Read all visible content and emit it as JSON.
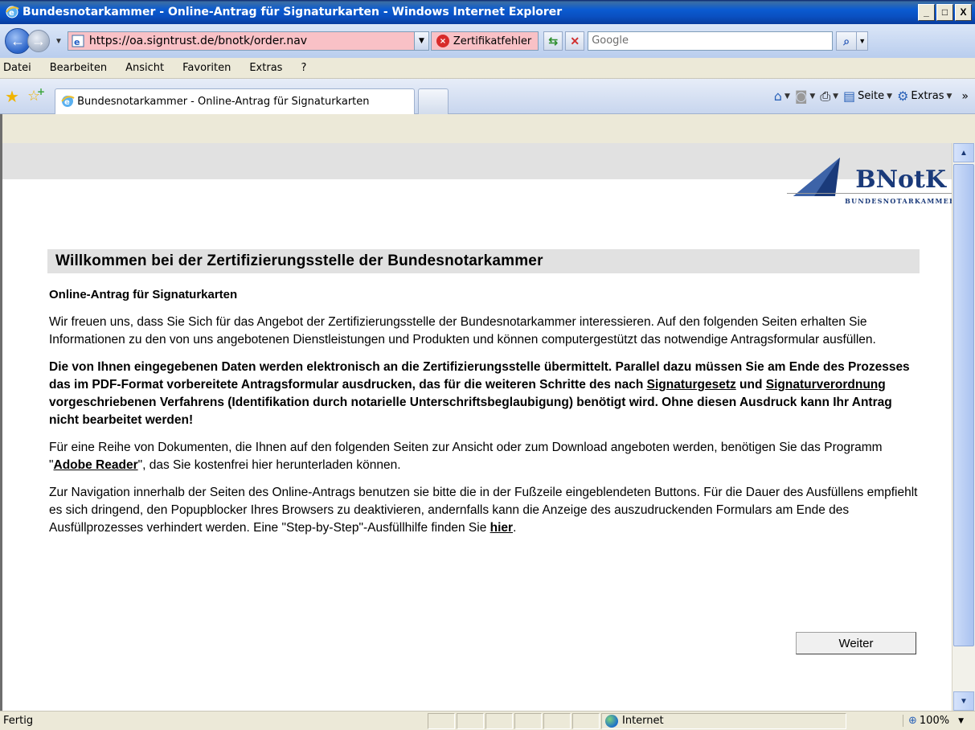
{
  "window": {
    "title": "Bundesnotarkammer - Online-Antrag für Signaturkarten - Windows Internet Explorer",
    "controls": [
      "_",
      "□",
      "X"
    ]
  },
  "address_bar": {
    "url": "https://oa.signtrust.de/bnotk/order.nav",
    "cert_error": "Zertifikatfehler",
    "search_placeholder": "Google"
  },
  "menu": [
    "Datei",
    "Bearbeiten",
    "Ansicht",
    "Favoriten",
    "Extras",
    "?"
  ],
  "tab": {
    "label": "Bundesnotarkammer - Online-Antrag für Signaturkarten"
  },
  "command_bar": {
    "page": "Seite",
    "tools": "Extras"
  },
  "logo": {
    "name": "BNotK",
    "subtitle": "BUNDESNOTARKAMMER"
  },
  "content": {
    "heading": "Willkommen bei der Zertifizierungsstelle der Bundesnotarkammer",
    "subheading": "Online-Antrag für Signaturkarten",
    "para1": "Wir freuen uns, dass Sie Sich für das Angebot der Zertifizierungsstelle der Bundesnotarkammer interessieren. Auf den folgenden Seiten erhalten Sie Informationen zu den von uns angebotenen Dienstleistungen und Produkten und können computergestützt das notwendige Antragsformular ausfüllen.",
    "para2_a": "Die von Ihnen eingegebenen Daten werden elektronisch an die Zertifizierungsstelle übermittelt. Parallel dazu müssen Sie am Ende des Prozesses das im PDF-Format vorbereitete Antragsformular ausdrucken, das für die weiteren Schritte des nach ",
    "link_signaturgesetz": "Signaturgesetz",
    "para2_b": " und ",
    "link_signaturverordnung": "Signaturverordnung",
    "para2_c": " vorgeschriebenen Verfahrens (Identifikation durch notarielle Unterschriftsbeglaubigung) benötigt wird. Ohne diesen Ausdruck kann Ihr Antrag nicht bearbeitet werden!",
    "para3_a": "Für eine Reihe von Dokumenten, die Ihnen auf den folgenden Seiten zur Ansicht oder zum Download angeboten werden, benötigen Sie das Programm \"",
    "link_adobe": "Adobe Reader",
    "para3_b": "\", das Sie kostenfrei hier herunterladen können.",
    "para4_a": "Zur Navigation innerhalb der Seiten des Online-Antrags benutzen sie bitte die in der Fußzeile eingeblendeten Buttons. Für die Dauer des Ausfüllens empfiehlt es sich dringend, den Popupblocker Ihres Browsers zu deaktivieren, andernfalls kann die Anzeige des auszudruckenden Formulars am Ende des Ausfüllprozesses verhindert werden. Eine \"Step-by-Step\"-Ausfüllhilfe finden Sie ",
    "link_hier": "hier",
    "para4_b": ".",
    "weiter_label": "Weiter"
  },
  "status_bar": {
    "status": "Fertig",
    "zone": "Internet",
    "zoom": "100%"
  }
}
